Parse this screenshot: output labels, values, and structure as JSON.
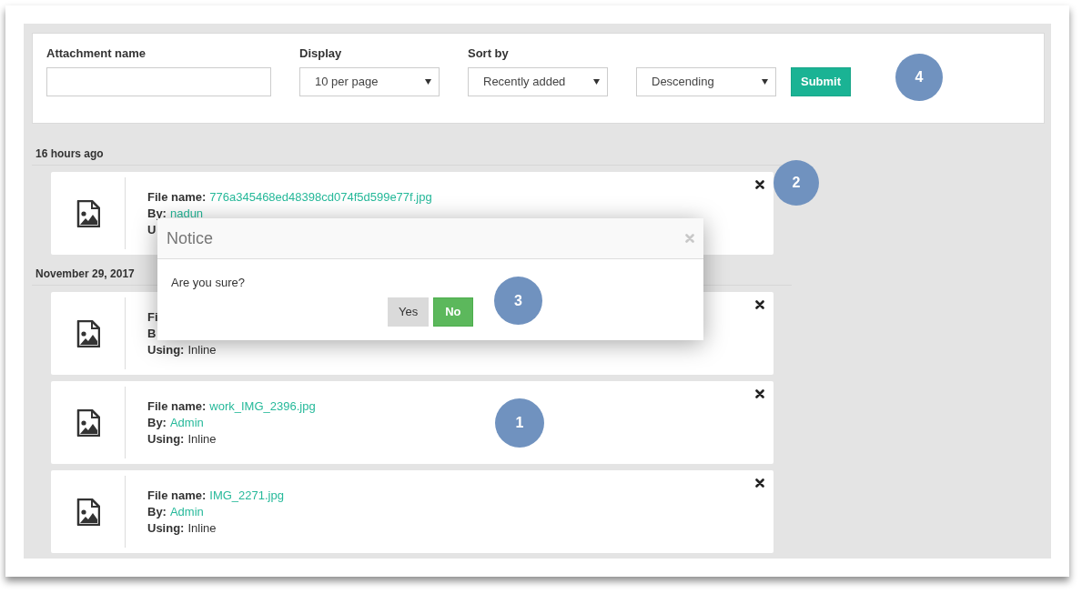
{
  "filters": {
    "fields": [
      {
        "kind": "text",
        "label": "Attachment name"
      },
      {
        "kind": "select",
        "label": "Display",
        "value": "10 per page"
      },
      {
        "kind": "select",
        "label": "Sort by",
        "value": "Recently added"
      },
      {
        "kind": "select",
        "value": "Descending"
      }
    ],
    "submit": "Submit",
    "callout": "4"
  },
  "groups": [
    {
      "heading": "16 hours ago",
      "cards": [
        {
          "lines": [
            {
              "label": "File name:",
              "value": "776a345468ed48398cd074f5d599e77f.jpg",
              "kind": "link"
            },
            {
              "label": "By:",
              "value": "nadun",
              "kind": "link"
            },
            {
              "label": "U"
            }
          ],
          "callout": "2"
        }
      ]
    },
    {
      "heading": "November 29, 2017",
      "cards": [
        {
          "lines": [
            {
              "label": "Fi"
            },
            {
              "label": "B"
            },
            {
              "label": "Using:",
              "value": "Inline",
              "kind": "text"
            }
          ]
        },
        {
          "lines": [
            {
              "label": "File name:",
              "value": "work_IMG_2396.jpg",
              "kind": "link"
            },
            {
              "label": "By:",
              "value": "Admin",
              "kind": "link"
            },
            {
              "label": "Using:",
              "value": "Inline",
              "kind": "text"
            }
          ],
          "callout": "1"
        },
        {
          "lines": [
            {
              "label": "File name:",
              "value": "IMG_2271.jpg",
              "kind": "link"
            },
            {
              "label": "By:",
              "value": "Admin",
              "kind": "link"
            },
            {
              "label": "Using:",
              "value": "Inline",
              "kind": "text"
            }
          ]
        }
      ]
    }
  ],
  "dialog": {
    "title": "Notice",
    "message": "Are you sure?",
    "buttons": [
      {
        "label": "Yes",
        "kind": "default"
      },
      {
        "label": "No",
        "kind": "primary"
      }
    ],
    "callout": "3"
  }
}
